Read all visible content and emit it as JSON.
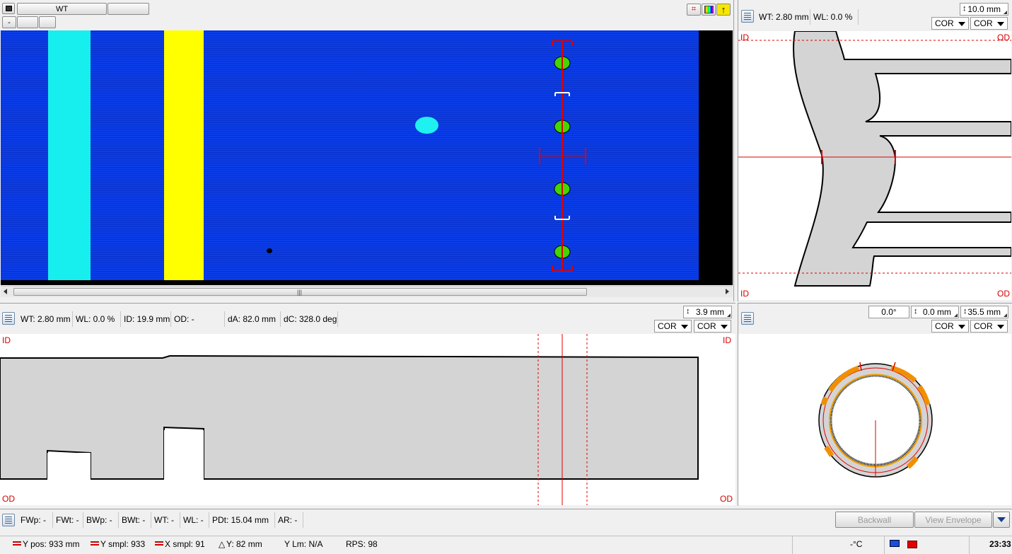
{
  "top_toolbar": {
    "tab_1": "WT",
    "tab_2": "",
    "minus_label": "-"
  },
  "cscan": {
    "colors": {
      "background": "#0a3fe6",
      "band_cyan": "#18f0f0",
      "band_yellow": "#ffff00",
      "indication_green": "#44d600",
      "cursor": "#e00000"
    }
  },
  "top_right": {
    "wt": "WT: 2.80 mm",
    "wl": "WL: 0.0 %",
    "range": "10.0 mm",
    "cor_1": "COR",
    "cor_2": "COR",
    "id_top": "ID",
    "od_top": "OD",
    "id_bottom": "ID",
    "od_bottom": "OD"
  },
  "bscan": {
    "wt": "WT: 2.80 mm",
    "wl": "WL: 0.0 %",
    "id": "ID: 19.9 mm",
    "od": "OD: -",
    "da": "dA: 82.0 mm",
    "dc": "dC: 328.0 deg",
    "range": "3.9 mm",
    "cor_1": "COR",
    "cor_2": "COR",
    "id_left": "ID",
    "id_right": "ID",
    "od_left": "OD",
    "od_right": "OD"
  },
  "circle": {
    "angle": "0.0°",
    "offset": "0.0 mm",
    "range": "35.5 mm",
    "cor_1": "COR",
    "cor_2": "COR"
  },
  "measure_bar": {
    "fwp": "FWp: -",
    "fwt": "FWt: -",
    "bwp": "BWp: -",
    "bwt": "BWt: -",
    "wt": "WT: -",
    "wl": "WL: -",
    "pdt": "PDt: 15.04 mm",
    "ar": "AR: -",
    "backwall": "Backwall",
    "view_envelope": "View Envelope"
  },
  "status_bar": {
    "y_pos": "Y pos: 933 mm",
    "y_smpl": "Y smpl: 933",
    "x_smpl": "X smpl: 91",
    "delta_y": "Y: 82 mm",
    "y_lm": "Y Lm: N/A",
    "rps": "RPS: 98",
    "temp": "-°C",
    "time": "23:33"
  }
}
